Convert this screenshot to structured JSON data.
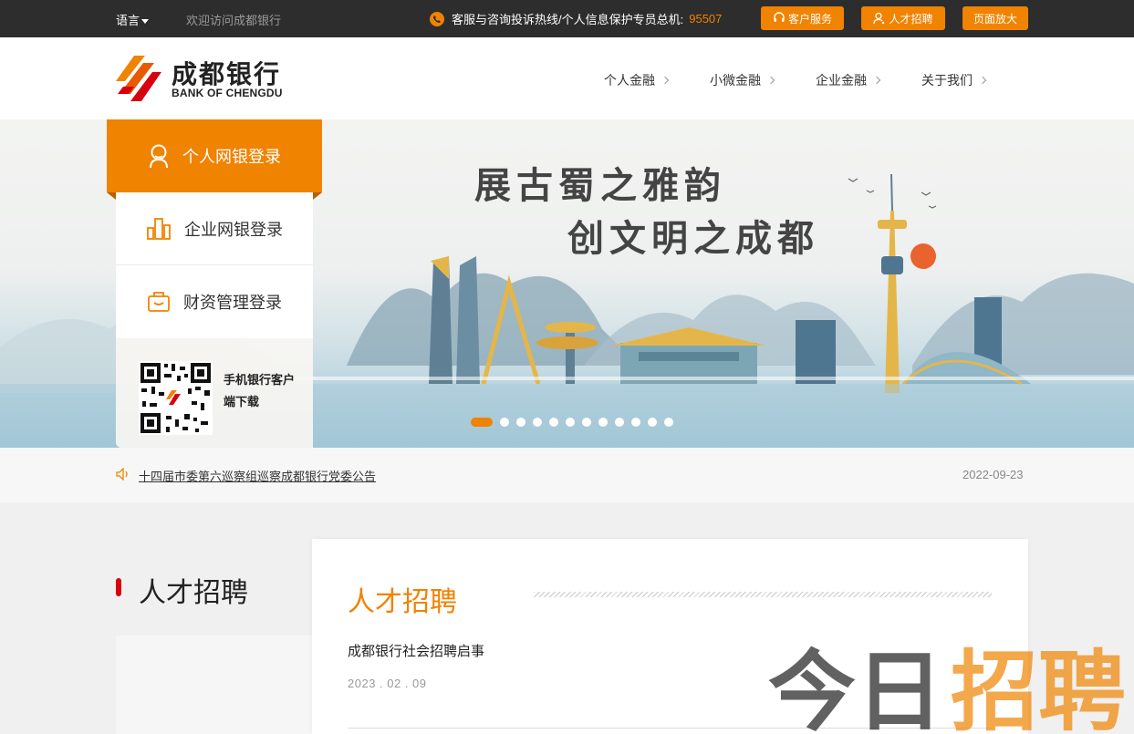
{
  "topbar": {
    "language": "语言",
    "welcome": "欢迎访问成都银行",
    "hotline_label": "客服与咨询投诉热线/个人信息保护专员总机:",
    "hotline_number": "95507",
    "buttons": {
      "service": "客户服务",
      "recruit": "人才招聘",
      "zoom": "页面放大"
    }
  },
  "header": {
    "logo_cn": "成都银行",
    "logo_en": "BANK OF CHENGDU",
    "nav": [
      "个人金融",
      "小微金融",
      "企业金融",
      "关于我们"
    ]
  },
  "banner": {
    "slogan_line1": "展古蜀之雅韵",
    "slogan_line2": "创文明之成都",
    "slide_count": 12,
    "active_slide": 1
  },
  "login": {
    "personal": "个人网银登录",
    "corporate": "企业网银登录",
    "wealth": "财资管理登录",
    "app_download": "手机银行客户端下载"
  },
  "notice": {
    "text": "十四届市委第六巡察组巡察成都银行党委公告",
    "date": "2022-09-23"
  },
  "content": {
    "side_title": "人才招聘",
    "card_title": "人才招聘",
    "news": [
      {
        "title": "成都银行社会招聘启事",
        "date": "2023 . 02 . 09"
      }
    ]
  },
  "watermark": {
    "text1": "今日",
    "text2": "招聘"
  },
  "colors": {
    "accent": "#f08300",
    "topbar": "#2d2d2d",
    "brand_red": "#d7000f"
  }
}
